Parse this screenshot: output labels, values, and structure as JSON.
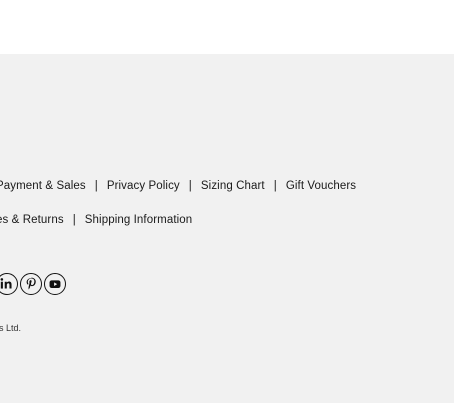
{
  "footer": {
    "links_row1": [
      {
        "label": "Payment & Sales"
      },
      {
        "label": "Privacy Policy"
      },
      {
        "label": "Sizing Chart"
      },
      {
        "label": "Gift Vouchers"
      }
    ],
    "links_row2": [
      {
        "label": "es & Returns"
      },
      {
        "label": "Shipping Information"
      }
    ],
    "separator": "|",
    "social_icons": [
      "linkedin-icon",
      "pinterest-icon",
      "youtube-icon"
    ],
    "copyright": "es Ltd."
  },
  "colors": {
    "background": "#ffffff",
    "footer_background": "#f1f1f1",
    "text": "#1a1a1a"
  }
}
